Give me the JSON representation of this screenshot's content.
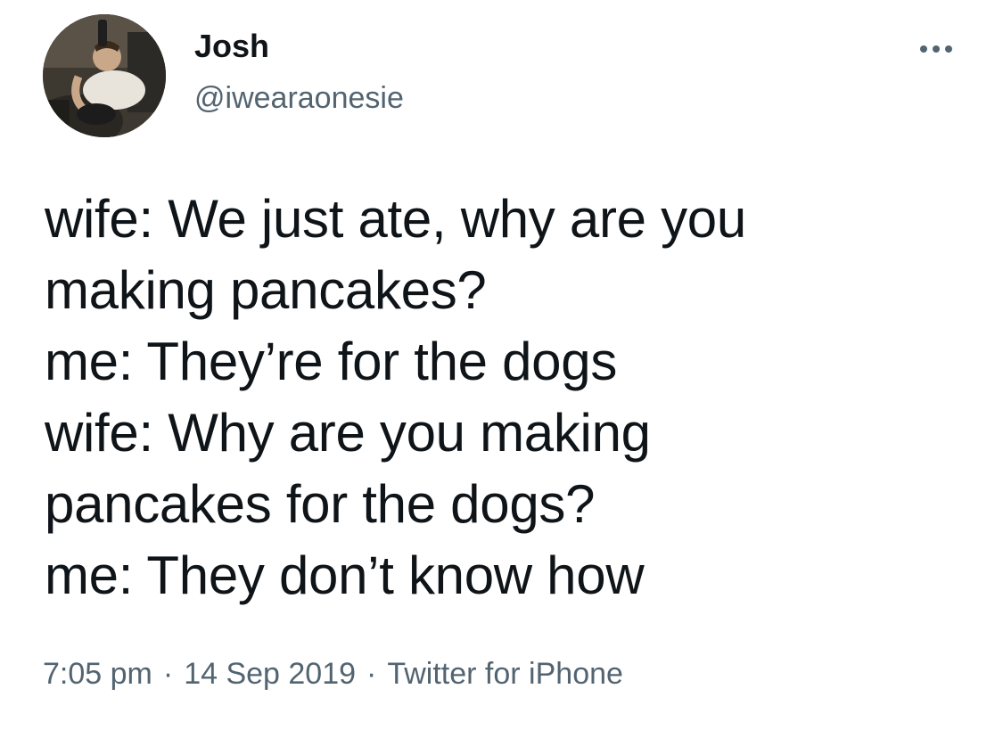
{
  "author": {
    "display_name": "Josh",
    "handle": "@iwearaonesie",
    "avatar_icon": "user-avatar-photo"
  },
  "menu": {
    "icon": "more-options-icon"
  },
  "tweet": {
    "lines": [
      "wife: We just ate, why are you",
      "making pancakes?",
      "me: They’re for the dogs",
      "wife: Why are you making",
      "pancakes for the dogs?",
      "me: They don’t know how"
    ]
  },
  "meta": {
    "time": "7:05 pm",
    "date": "14 Sep 2019",
    "separator": "·",
    "source": "Twitter for iPhone"
  },
  "colors": {
    "text_primary": "#0f1419",
    "text_secondary": "#536471",
    "background": "#ffffff"
  }
}
